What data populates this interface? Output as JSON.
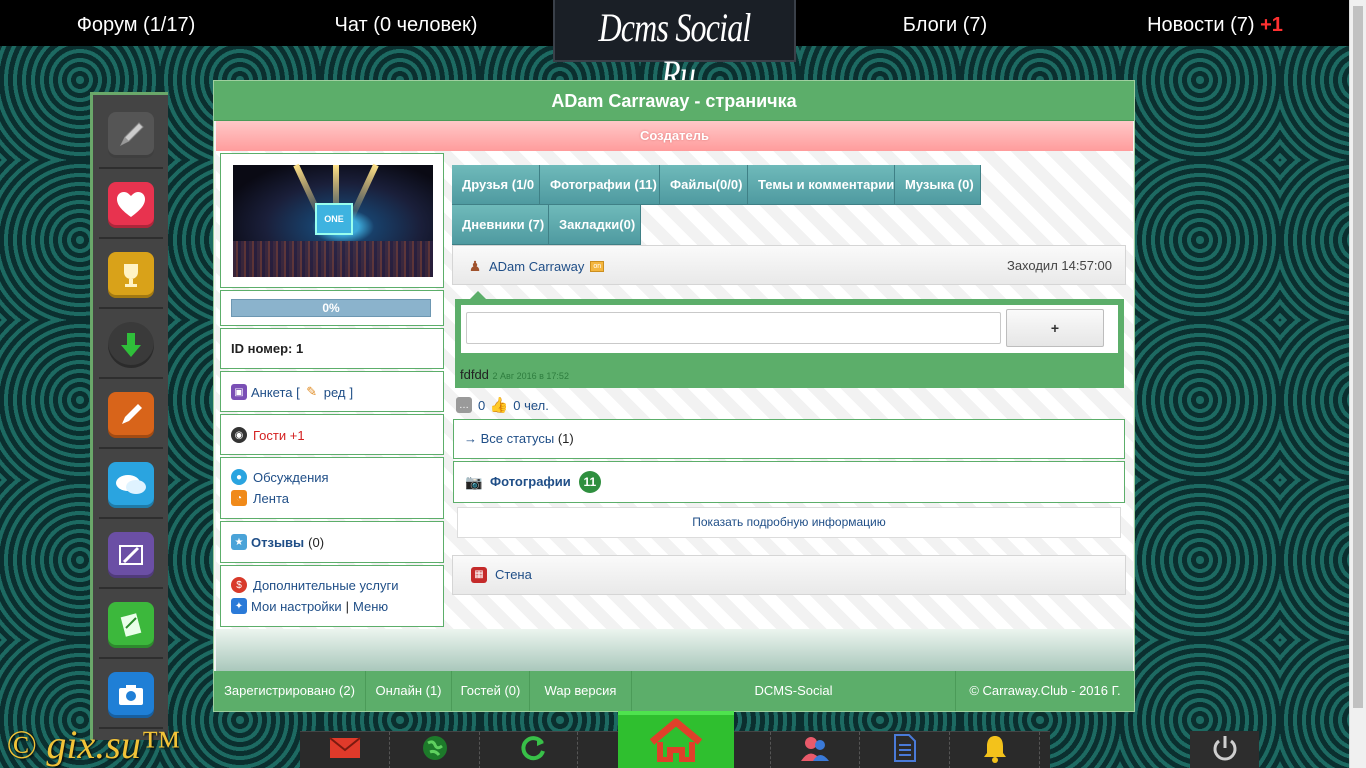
{
  "topbar": {
    "forum": "Форум (1/17)",
    "chat": "Чат (0 человек)",
    "logo": "Dcms Social .Ru",
    "blogs": "Блоги (7)",
    "news": "Новости (7)",
    "news_new": "+1"
  },
  "page": {
    "title": "ADam Carraway - страничка",
    "role": "Создатель"
  },
  "avatar": {
    "screen_text": "ONE"
  },
  "profile": {
    "progress": "0%",
    "progress_value": 0,
    "id_label": "ID номер: 1",
    "anketa": "Анкета [",
    "anketa_edit": "ред",
    "anketa_close": "]",
    "guests": "Гости +1",
    "discussions": "Обсуждения",
    "feed": "Лента",
    "reviews": "Отзывы",
    "reviews_count": "(0)",
    "extra_services": "Дополнительные услуги",
    "my_settings": "Мои настройки",
    "separator": "|",
    "menu": "Меню"
  },
  "tabs": [
    {
      "label": "Друзья (1/0"
    },
    {
      "label": "Фотографии (11)"
    },
    {
      "label": "Файлы(0/0)"
    },
    {
      "label": "Темы и комментарии"
    },
    {
      "label": "Музыка (0)"
    },
    {
      "label": "Дневники (7)"
    },
    {
      "label": "Закладки(0)"
    }
  ],
  "user": {
    "name": "ADam Carraway",
    "online_badge": "on",
    "last_visit": "Заходил 14:57:00"
  },
  "status": {
    "input_value": "",
    "add_button": "+",
    "text": "fdfdd",
    "date": "2 Авг 2016 в 17:52",
    "comments": "0",
    "likes": "0 чел."
  },
  "sections": {
    "all_statuses": "→ Все статусы",
    "all_statuses_count": "(1)",
    "photos": "Фотографии",
    "photos_count": "11",
    "more_info": "Показать подробную информацию",
    "wall": "Стена"
  },
  "footer": {
    "registered": "Зарегистрировано (2)",
    "online": "Онлайн (1)",
    "guests": "Гостей (0)",
    "wap": "Wap версия",
    "engine": "DCMS-Social",
    "copyright": "© Carraway.Club - 2016 Г."
  },
  "watermark": "© gix.su™",
  "icons": {
    "side": [
      "pen-icon",
      "heart-icon",
      "trophy-icon",
      "download-icon",
      "edit-icon",
      "chat-icon",
      "image-edit-icon",
      "notepad-icon",
      "camera-icon"
    ],
    "dock": [
      "mail-icon",
      "globe-icon",
      "refresh-icon",
      "home-icon",
      "users-icon",
      "document-icon",
      "bell-icon",
      "power-icon"
    ]
  },
  "colors": {
    "accent_green": "#5cae6a",
    "tab_teal": "#5aa6aa",
    "creator_pink": "#ffb0b0",
    "link_blue": "#1f4e87",
    "alert_red": "#ff3030"
  }
}
